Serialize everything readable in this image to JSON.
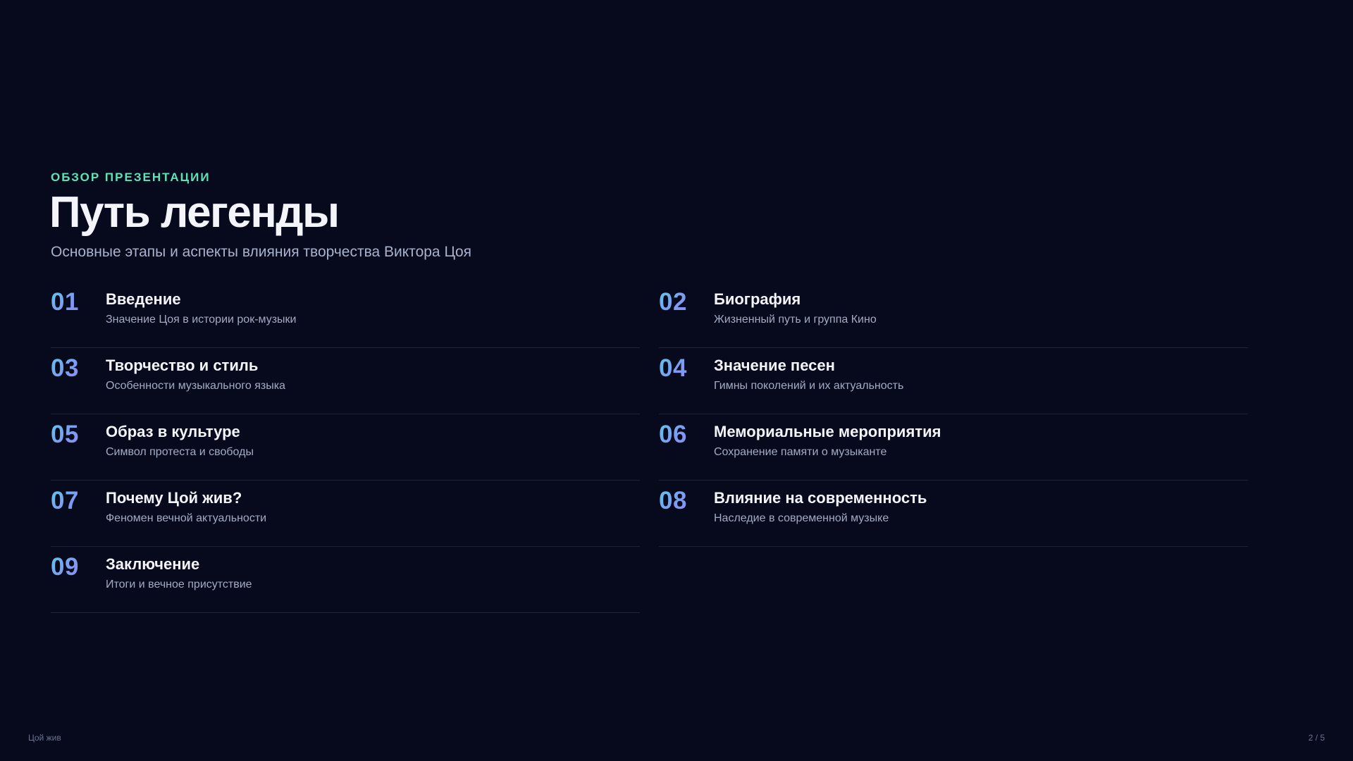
{
  "header": {
    "eyebrow": "ОБЗОР ПРЕЗЕНТАЦИИ",
    "title": "Путь легенды",
    "subtitle": "Основные этапы и аспекты влияния творчества Виктора Цоя"
  },
  "items": [
    {
      "num": "01",
      "title": "Введение",
      "desc": "Значение Цоя в истории рок-музыки"
    },
    {
      "num": "02",
      "title": "Биография",
      "desc": "Жизненный путь и группа Кино"
    },
    {
      "num": "03",
      "title": "Творчество и стиль",
      "desc": "Особенности музыкального языка"
    },
    {
      "num": "04",
      "title": "Значение песен",
      "desc": "Гимны поколений и их актуальность"
    },
    {
      "num": "05",
      "title": "Образ в культуре",
      "desc": "Символ протеста и свободы"
    },
    {
      "num": "06",
      "title": "Мемориальные мероприятия",
      "desc": "Сохранение памяти о музыканте"
    },
    {
      "num": "07",
      "title": "Почему Цой жив?",
      "desc": "Феномен вечной актуальности"
    },
    {
      "num": "08",
      "title": "Влияние на современность",
      "desc": "Наследие в современной музыке"
    },
    {
      "num": "09",
      "title": "Заключение",
      "desc": "Итоги и вечное присутствие"
    }
  ],
  "footer": {
    "left": "Цой жив",
    "page": "2 / 5"
  },
  "colors": {
    "background": "#070a1c",
    "accent": "#5ee3b6",
    "number_gradient_start": "#5fc8ec",
    "number_gradient_end": "#8b8cf2"
  }
}
